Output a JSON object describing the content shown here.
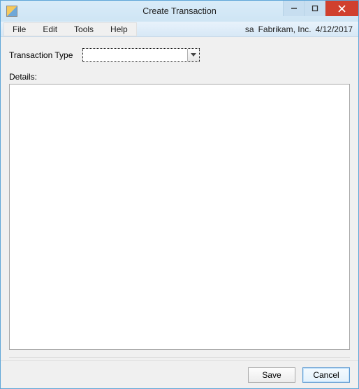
{
  "window": {
    "title": "Create Transaction"
  },
  "menubar": {
    "items": [
      "File",
      "Edit",
      "Tools",
      "Help"
    ],
    "user": "sa",
    "company": "Fabrikam, Inc.",
    "date": "4/12/2017"
  },
  "form": {
    "type_label": "Transaction Type",
    "type_value": "",
    "details_label": "Details:",
    "details_value": ""
  },
  "footer": {
    "save_label": "Save",
    "cancel_label": "Cancel"
  }
}
